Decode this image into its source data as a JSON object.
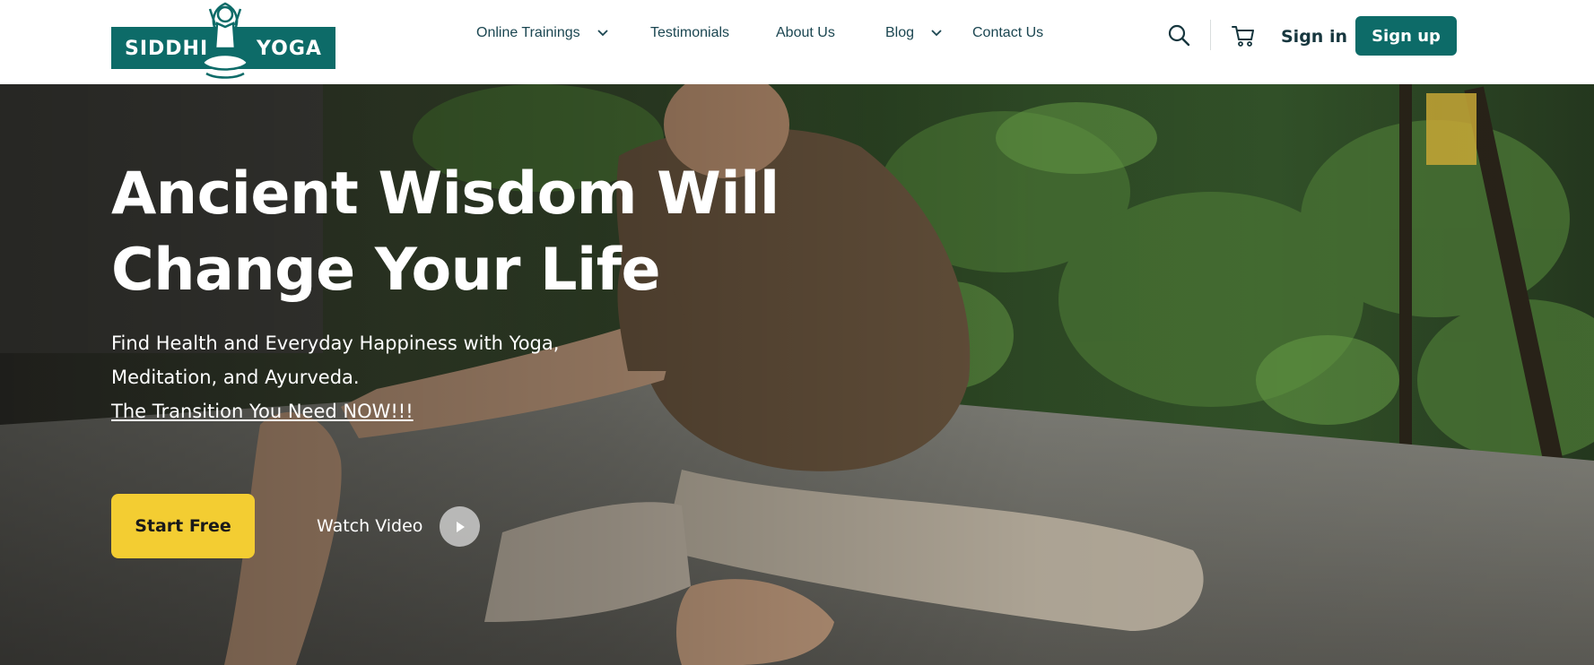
{
  "brand": {
    "name_left": "SIDDHI",
    "name_right": "YOGA",
    "logo_color": "#0d6b68"
  },
  "nav": {
    "items": [
      {
        "label": "Online Trainings",
        "has_dropdown": true
      },
      {
        "label": "Testimonials",
        "has_dropdown": false
      },
      {
        "label": "About Us",
        "has_dropdown": false
      },
      {
        "label": "Blog",
        "has_dropdown": true
      },
      {
        "label": "Contact Us",
        "has_dropdown": false
      }
    ],
    "search_icon": "search-icon",
    "cart_icon": "cart-icon",
    "signin_label": "Sign in",
    "signup_label": "Sign up"
  },
  "hero": {
    "headline_line1": "Ancient Wisdom Will",
    "headline_line2": "Change Your Life",
    "sub_line1": "Find Health and Everyday Happiness with Yoga,",
    "sub_line2": "Meditation, and Ayurveda.",
    "sub_link": "The Transition You Need NOW!!!",
    "start_label": "Start Free",
    "watch_label": "Watch Video",
    "play_icon": "play-icon"
  },
  "colors": {
    "accent": "#0d6b68",
    "cta": "#f3cd32",
    "nav_text": "#1b4651"
  }
}
